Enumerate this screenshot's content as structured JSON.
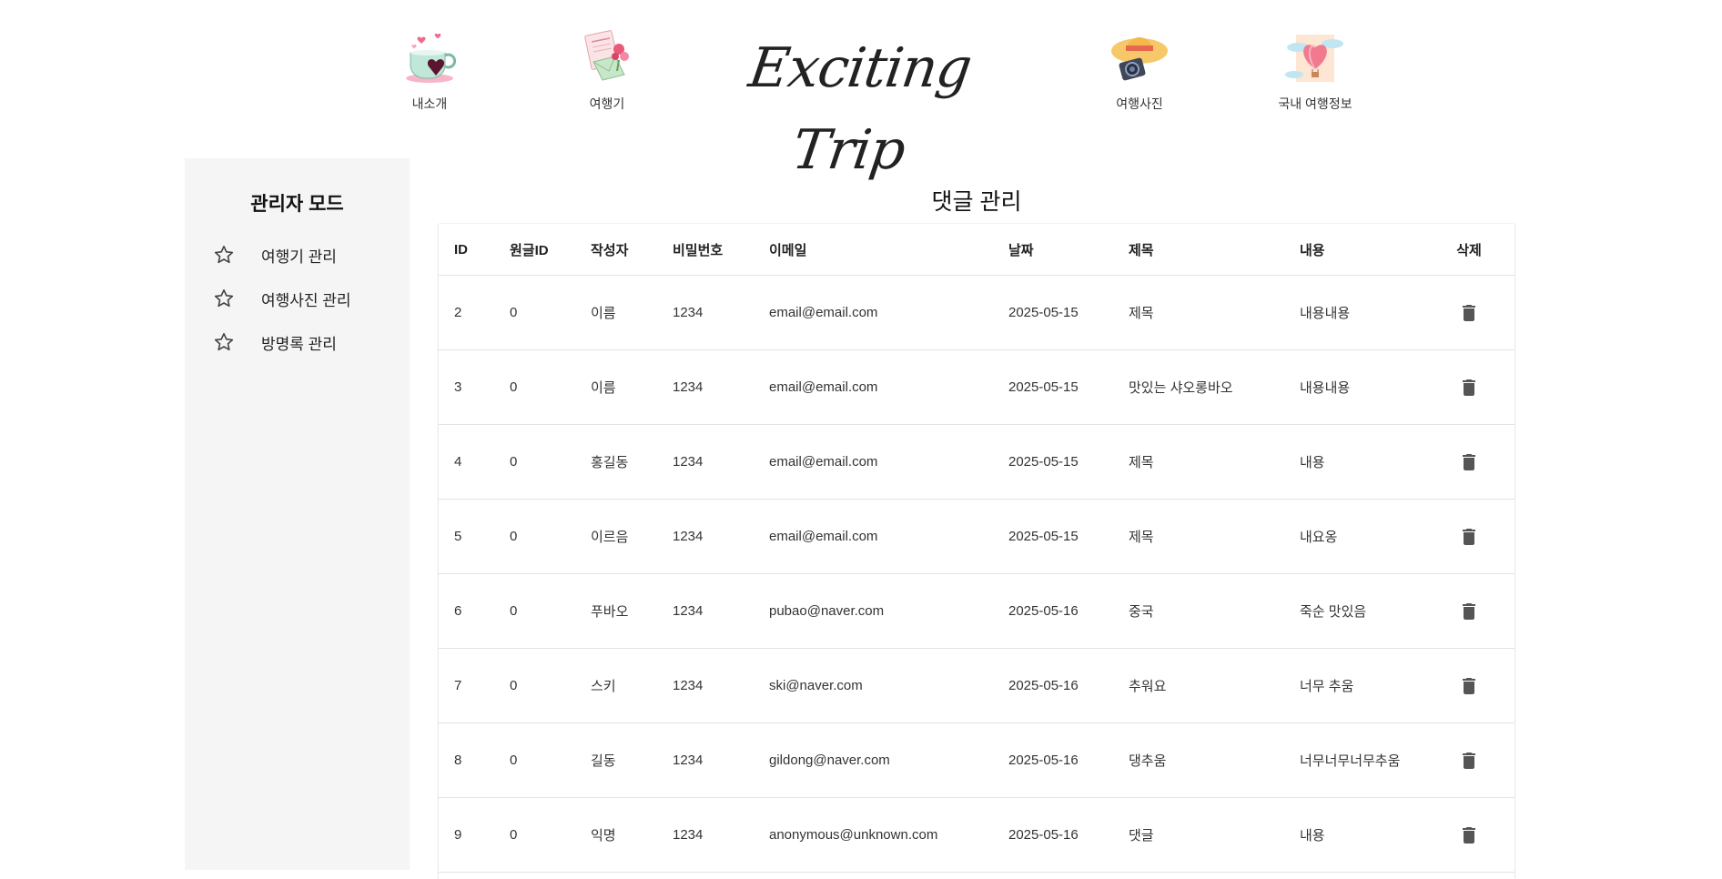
{
  "header": {
    "logo_text": "Exciting Trip",
    "nav": [
      {
        "label": "내소개",
        "icon": "teacup-hearts-icon"
      },
      {
        "label": "여행기",
        "icon": "love-letter-icon"
      },
      {
        "label": "여행사진",
        "icon": "hat-camera-icon"
      },
      {
        "label": "국내 여행정보",
        "icon": "heart-balloon-card-icon"
      }
    ]
  },
  "sidebar": {
    "title": "관리자 모드",
    "items": [
      {
        "label": "여행기 관리",
        "icon": "star-icon"
      },
      {
        "label": "여행사진 관리",
        "icon": "star-icon"
      },
      {
        "label": "방명록 관리",
        "icon": "star-icon"
      }
    ]
  },
  "main": {
    "title": "댓글 관리",
    "columns": [
      "ID",
      "원글ID",
      "작성자",
      "비밀번호",
      "이메일",
      "날짜",
      "제목",
      "내용",
      "삭제"
    ],
    "rows": [
      [
        "2",
        "0",
        "이름",
        "1234",
        "email@email.com",
        "2025-05-15",
        "제목",
        "내용내용"
      ],
      [
        "3",
        "0",
        "이름",
        "1234",
        "email@email.com",
        "2025-05-15",
        "맛있는 샤오롱바오",
        "내용내용"
      ],
      [
        "4",
        "0",
        "홍길동",
        "1234",
        "email@email.com",
        "2025-05-15",
        "제목",
        "내용"
      ],
      [
        "5",
        "0",
        "이르음",
        "1234",
        "email@email.com",
        "2025-05-15",
        "제목",
        "내요옹"
      ],
      [
        "6",
        "0",
        "푸바오",
        "1234",
        "pubao@naver.com",
        "2025-05-16",
        "중국",
        "죽순 맛있음"
      ],
      [
        "7",
        "0",
        "스키",
        "1234",
        "ski@naver.com",
        "2025-05-16",
        "추워요",
        "너무 추움"
      ],
      [
        "8",
        "0",
        "길동",
        "1234",
        "gildong@naver.com",
        "2025-05-16",
        "댕추움",
        "너무너무너무추움"
      ],
      [
        "9",
        "0",
        "익명",
        "1234",
        "anonymous@unknown.com",
        "2025-05-16",
        "댓글",
        "내용"
      ]
    ],
    "delete_icon": "trash-icon"
  }
}
